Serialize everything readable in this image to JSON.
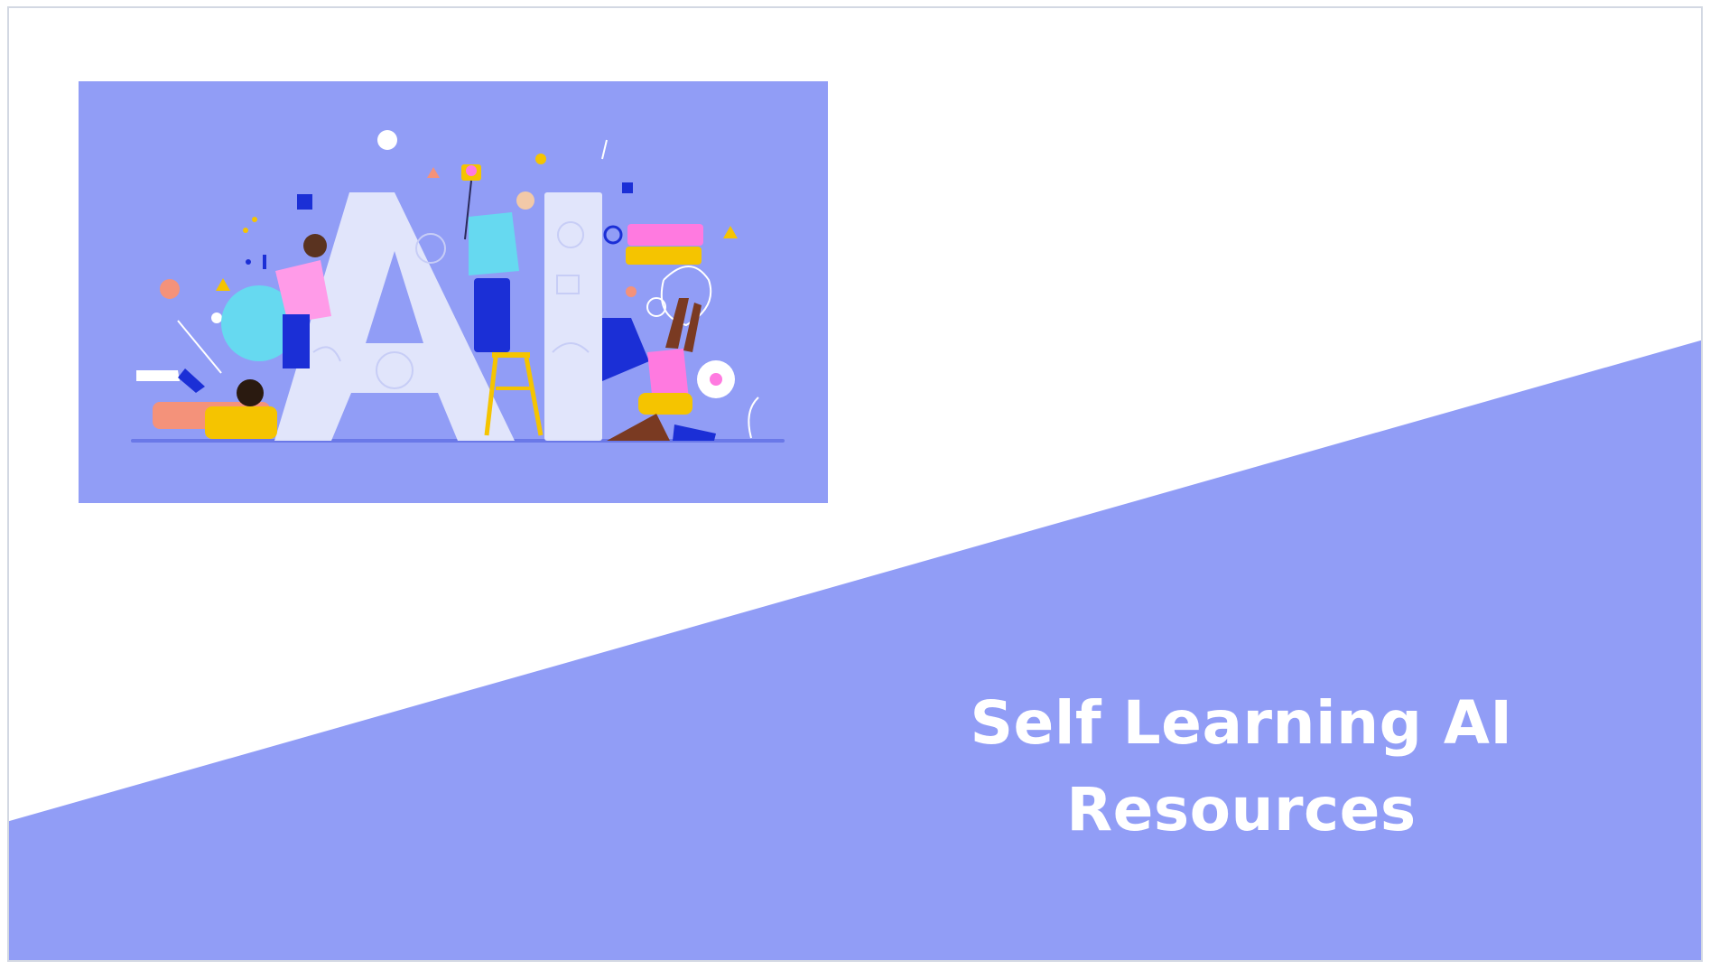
{
  "slide": {
    "title_line1": "Self Learning AI",
    "title_line2": "Resources",
    "accent_color": "#919df6",
    "background_color": "#ffffff"
  },
  "illustration": {
    "letters": "AI",
    "background_color": "#919df6"
  }
}
